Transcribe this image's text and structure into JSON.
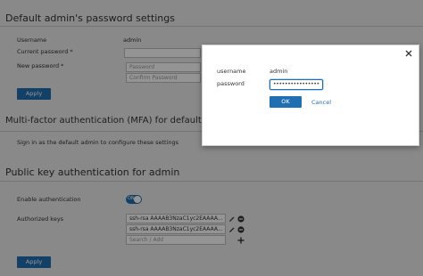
{
  "password_section": {
    "title": "Default admin's password settings",
    "username_label": "Username",
    "username_value": "admin",
    "current_password_label": "Current password *",
    "new_password_label": "New password *",
    "password_placeholder": "Password",
    "confirm_placeholder": "Confirm Password",
    "apply_label": "Apply"
  },
  "mfa_section": {
    "title": "Multi-factor authentication (MFA) for default admin",
    "note": "Sign in as the default admin to configure these settings"
  },
  "pubkey_section": {
    "title": "Public key authentication for admin",
    "enable_label": "Enable authentication",
    "toggle_text": "ON",
    "toggle_on": true,
    "keys_label": "Authorized keys",
    "keys": [
      {
        "value": "ssh-rsa AAAAB3NzaC1yc2EAAAA..."
      },
      {
        "value": "ssh-rsa AAAAB3NzaC1yc2EAAAA..."
      }
    ],
    "search_placeholder": "Search / Add",
    "apply_label": "Apply"
  },
  "modal": {
    "username_label": "username",
    "username_value": "admin",
    "password_label": "password",
    "password_value": "••••••••••••••••",
    "ok_label": "OK",
    "cancel_label": "Cancel",
    "close_icon": "close-icon"
  },
  "colors": {
    "accent": "#1f6fb2",
    "overlay": "rgba(0,0,0,0.42)"
  }
}
